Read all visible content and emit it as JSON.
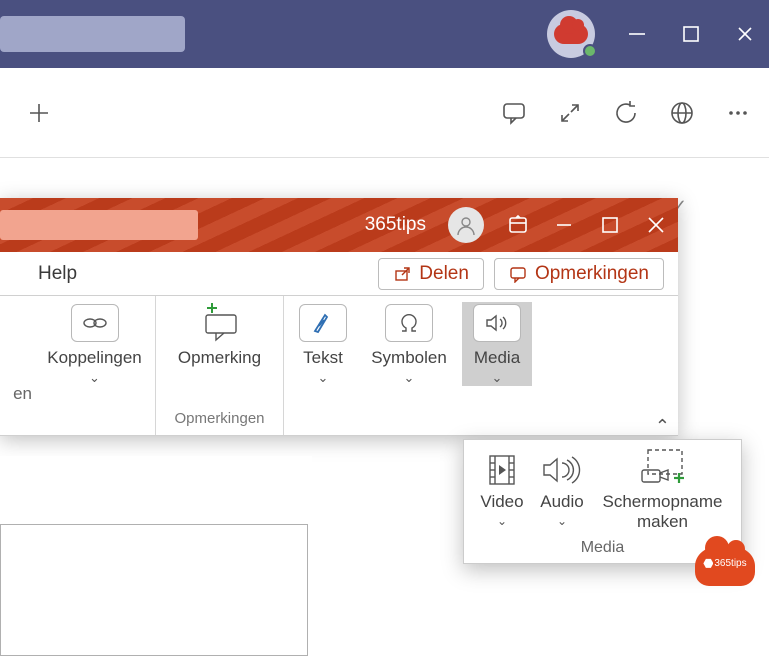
{
  "teams": {
    "window_controls": {
      "minimize": "−",
      "maximize": "☐",
      "close": "✕"
    },
    "toolbar_icons": {
      "new": "plus",
      "comment": "comment",
      "expand": "expand",
      "refresh": "refresh",
      "globe": "globe",
      "more": "more"
    }
  },
  "powerpoint": {
    "user_name": "365tips",
    "actions": {
      "share_label": "Delen",
      "comments_label": "Opmerkingen"
    },
    "tabs": {
      "help": "Help"
    },
    "ribbon": {
      "cut_group_partial": "en",
      "links": {
        "label": "Koppelingen"
      },
      "comment_btn": {
        "label": "Opmerking"
      },
      "comments_group_label": "Opmerkingen",
      "text": {
        "label": "Tekst"
      },
      "symbols": {
        "label": "Symbolen"
      },
      "media": {
        "label": "Media"
      }
    },
    "media_panel": {
      "video": "Video",
      "audio": "Audio",
      "screen_recording": "Schermopname maken",
      "footer": "Media"
    }
  },
  "badge": {
    "text": "365tips"
  }
}
